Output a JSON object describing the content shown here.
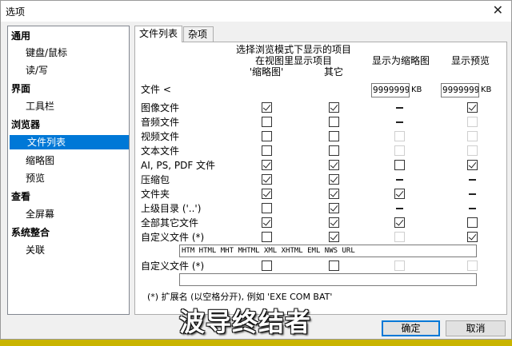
{
  "window": {
    "title": "选项"
  },
  "sidebar": {
    "items": [
      {
        "label": "通用",
        "kind": "category"
      },
      {
        "label": "键盘/鼠标",
        "kind": "sub"
      },
      {
        "label": "读/写",
        "kind": "sub"
      },
      {
        "label": "界面",
        "kind": "category"
      },
      {
        "label": "工具栏",
        "kind": "sub"
      },
      {
        "label": "浏览器",
        "kind": "category"
      },
      {
        "label": "文件列表",
        "kind": "sub",
        "selected": true
      },
      {
        "label": "缩略图",
        "kind": "sub"
      },
      {
        "label": "预览",
        "kind": "sub"
      },
      {
        "label": "查看",
        "kind": "category"
      },
      {
        "label": "全屏幕",
        "kind": "sub"
      },
      {
        "label": "系统整合",
        "kind": "category"
      },
      {
        "label": "关联",
        "kind": "sub"
      }
    ]
  },
  "tabs": [
    {
      "label": "文件列表",
      "active": true
    },
    {
      "label": "杂项",
      "active": false
    }
  ],
  "headers": {
    "group_line1": "选择浏览模式下显示的项目",
    "group_line2": "在视图里显示项目",
    "col1": "'缩略图'",
    "col2": "其它",
    "col3": "显示为缩略图",
    "col4": "显示预览"
  },
  "file_size_row": {
    "label": "文件 <",
    "thumb_size_value": "99999999",
    "preview_size_value": "99999999",
    "unit": "KB"
  },
  "rows": [
    {
      "label": "图像文件",
      "c1": "checked",
      "c2": "checked",
      "c3": "dash",
      "c4": "checked"
    },
    {
      "label": "音频文件",
      "c1": "unchecked",
      "c2": "unchecked",
      "c3": "dash",
      "c4": "disabled"
    },
    {
      "label": "视频文件",
      "c1": "unchecked",
      "c2": "unchecked",
      "c3": "disabled",
      "c4": "disabled"
    },
    {
      "label": "文本文件",
      "c1": "unchecked",
      "c2": "unchecked",
      "c3": "disabled",
      "c4": "disabled"
    },
    {
      "label": "AI, PS, PDF 文件",
      "c1": "checked",
      "c2": "checked",
      "c3": "unchecked",
      "c4": "checked"
    },
    {
      "label": "压缩包",
      "c1": "checked",
      "c2": "checked",
      "c3": "dash",
      "c4": "dash"
    },
    {
      "label": "文件夹",
      "c1": "checked",
      "c2": "checked",
      "c3": "checked",
      "c4": "dash"
    },
    {
      "label": "上级目录 ('..')",
      "c1": "unchecked",
      "c2": "checked",
      "c3": "dash",
      "c4": "dash"
    },
    {
      "label": "全部其它文件",
      "c1": "checked",
      "c2": "checked",
      "c3": "checked",
      "c4": "unchecked"
    },
    {
      "label": "自定义文件 (*)",
      "c1": "unchecked",
      "c2": "checked",
      "c3": "disabled",
      "c4": "checked"
    },
    {
      "label": "自定义文件 (*)",
      "c1": "unchecked",
      "c2": "unchecked",
      "c3": "disabled",
      "c4": "disabled"
    }
  ],
  "custom_ext": {
    "ext1": "HTM HTML MHT MHTML XML XHTML EML NWS URL",
    "ext2": ""
  },
  "note": "(*) 扩展名 (以空格分开), 例如 'EXE COM BAT'",
  "buttons": {
    "ok": "确定",
    "cancel": "取消"
  },
  "watermark": "波导终结者",
  "colors": {
    "selection": "#0078d7",
    "panel": "#ffffff",
    "dialog": "#f0f0f0"
  }
}
